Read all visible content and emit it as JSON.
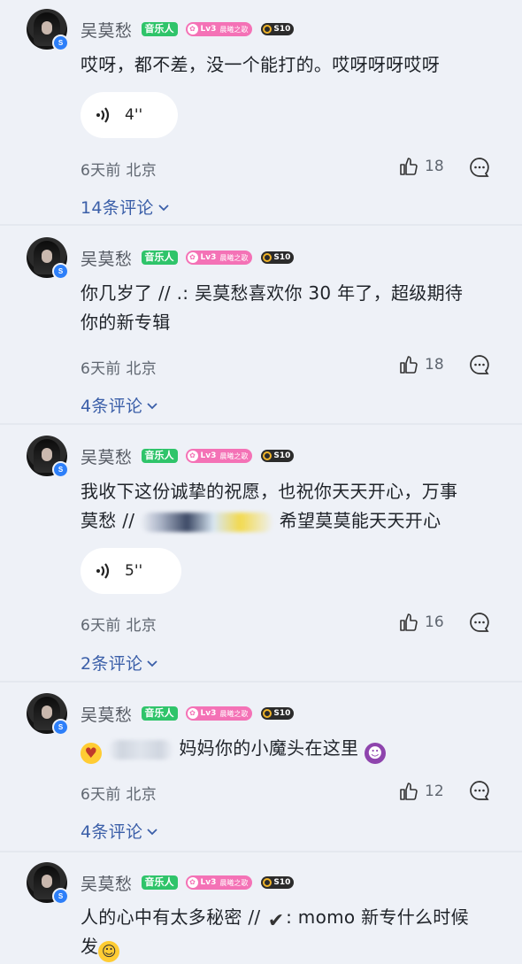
{
  "comments": [
    {
      "user": "吴莫愁",
      "tag_music": "音乐人",
      "tag_level": "Lv3",
      "tag_level_name": "晨曦之歌",
      "tag_badge": "S10",
      "text": "哎呀，都不差，没一个能打的。哎呀呀呀哎呀",
      "voice_duration": "4''",
      "meta": "6天前 北京",
      "likes": "18",
      "replies": "14条评论"
    },
    {
      "user": "吴莫愁",
      "tag_music": "音乐人",
      "tag_level": "Lv3",
      "tag_level_name": "晨曦之歌",
      "tag_badge": "S10",
      "text_line1": "你几岁了 // .: 吴莫愁喜欢你 30 年了，超级期待",
      "text_line2": "你的新专辑",
      "meta": "6天前 北京",
      "likes": "18",
      "replies": "4条评论"
    },
    {
      "user": "吴莫愁",
      "tag_music": "音乐人",
      "tag_level": "Lv3",
      "tag_level_name": "晨曦之歌",
      "tag_badge": "S10",
      "text_line1": "我收下这份诚挚的祝愿，也祝你天天开心，万事",
      "text_line2_a": "莫愁 //",
      "text_line2_b": "希望莫莫能天天开心",
      "voice_duration": "5''",
      "meta": "6天前 北京",
      "likes": "16",
      "replies": "2条评论"
    },
    {
      "user": "吴莫愁",
      "tag_music": "音乐人",
      "tag_level": "Lv3",
      "tag_level_name": "晨曦之歌",
      "tag_badge": "S10",
      "text": "妈妈你的小魔头在这里",
      "meta": "6天前 北京",
      "likes": "12",
      "replies": "4条评论"
    },
    {
      "user": "吴莫愁",
      "tag_music": "音乐人",
      "tag_level": "Lv3",
      "tag_level_name": "晨曦之歌",
      "tag_badge": "S10",
      "text_line1_a": "人的心中有太多秘密 //",
      "text_line1_b": ": momo 新专什么时候",
      "text_line2": "发"
    }
  ],
  "icons": {
    "verify": "verified-badge-icon",
    "like": "thumbs-up-icon",
    "reply": "comment-bubble-icon",
    "voice": "sound-wave-icon",
    "chevron": "chevron-down-icon"
  },
  "colors": {
    "background": "#eef1f7",
    "link": "#3a5ea8",
    "music_tag": "#2fc46a",
    "level_tag": "#f472b6"
  }
}
